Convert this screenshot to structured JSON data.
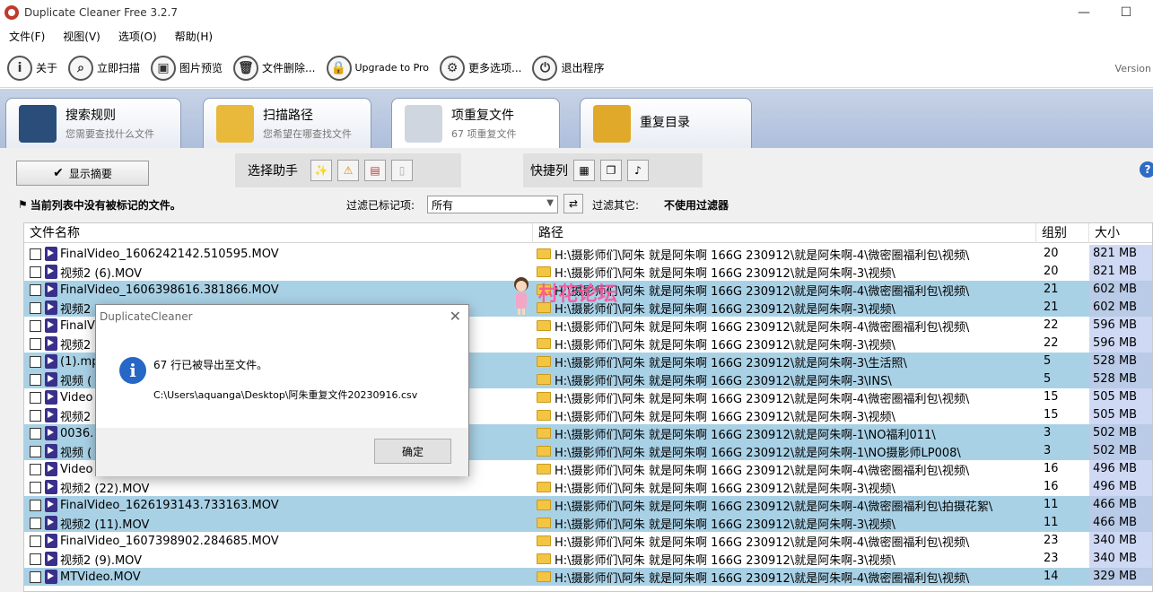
{
  "window": {
    "title": "Duplicate Cleaner Free 3.2.7",
    "minimize": "—",
    "maximize": "☐"
  },
  "menu": [
    "文件(F)",
    "视图(V)",
    "选项(O)",
    "帮助(H)"
  ],
  "toolbar": {
    "buttons": [
      {
        "label": "关于",
        "icon": "i"
      },
      {
        "label": "立即扫描",
        "icon": "⌕"
      },
      {
        "label": "图片预览",
        "icon": "▣"
      },
      {
        "label": "文件删除...",
        "icon": "🗑"
      },
      {
        "label": "Upgrade to Pro",
        "icon": "🔒"
      },
      {
        "label": "更多选项...",
        "icon": "⚙"
      },
      {
        "label": "退出程序",
        "icon": "⏻"
      }
    ],
    "version": "Version"
  },
  "tabs": [
    {
      "title": "搜索规则",
      "subtitle": "您需要查找什么文件",
      "icon_color": "#2b4d7a"
    },
    {
      "title": "扫描路径",
      "subtitle": "您希望在哪查找文件",
      "icon_color": "#e8b93a"
    },
    {
      "title": "项重复文件",
      "subtitle": "67 项重复文件",
      "icon_color": "#cfd6df"
    },
    {
      "title": "重复目录",
      "subtitle": "",
      "icon_color": "#e0a92a"
    }
  ],
  "panel": {
    "summary_button": "显示摘要",
    "helper_label": "选择助手",
    "quick_label": "快捷列",
    "status": "当前列表中没有被标记的文件。",
    "filter_marked_label": "过滤已标记项:",
    "filter_value": "所有",
    "filter_other_label": "过滤其它:",
    "filter_other_value": "不使用过滤器",
    "help": "?"
  },
  "table": {
    "headers": [
      "文件名称",
      "路径",
      "组别",
      "大小"
    ],
    "rows": [
      {
        "name": "FinalVideo_1606242142.510595.MOV",
        "path": "H:\\摄影师们\\阿朱 就是阿朱啊 166G 230912\\就是阿朱啊-4\\微密圈福利包\\视频\\",
        "group": "20",
        "size": "821 MB",
        "hl": false
      },
      {
        "name": "视频2 (6).MOV",
        "path": "H:\\摄影师们\\阿朱 就是阿朱啊 166G 230912\\就是阿朱啊-3\\视频\\",
        "group": "20",
        "size": "821 MB",
        "hl": false
      },
      {
        "name": "FinalVideo_1606398616.381866.MOV",
        "path": "H:\\摄影师们\\阿朱 就是阿朱啊 166G 230912\\就是阿朱啊-4\\微密圈福利包\\视频\\",
        "group": "21",
        "size": "602 MB",
        "hl": true
      },
      {
        "name": "视频2",
        "path": "H:\\摄影师们\\阿朱 就是阿朱啊 166G 230912\\就是阿朱啊-3\\视频\\",
        "group": "21",
        "size": "602 MB",
        "hl": true
      },
      {
        "name": "FinalV",
        "path": "H:\\摄影师们\\阿朱 就是阿朱啊 166G 230912\\就是阿朱啊-4\\微密圈福利包\\视频\\",
        "group": "22",
        "size": "596 MB",
        "hl": false
      },
      {
        "name": "视频2",
        "path": "H:\\摄影师们\\阿朱 就是阿朱啊 166G 230912\\就是阿朱啊-3\\视频\\",
        "group": "22",
        "size": "596 MB",
        "hl": false
      },
      {
        "name": "(1).mp",
        "path": "H:\\摄影师们\\阿朱 就是阿朱啊 166G 230912\\就是阿朱啊-3\\生活照\\",
        "group": "5",
        "size": "528 MB",
        "hl": true
      },
      {
        "name": "视频 (",
        "path": "H:\\摄影师们\\阿朱 就是阿朱啊 166G 230912\\就是阿朱啊-3\\INS\\",
        "group": "5",
        "size": "528 MB",
        "hl": true
      },
      {
        "name": "Video",
        "path": "H:\\摄影师们\\阿朱 就是阿朱啊 166G 230912\\就是阿朱啊-4\\微密圈福利包\\视频\\",
        "group": "15",
        "size": "505 MB",
        "hl": false
      },
      {
        "name": "视频2",
        "path": "H:\\摄影师们\\阿朱 就是阿朱啊 166G 230912\\就是阿朱啊-3\\视频\\",
        "group": "15",
        "size": "505 MB",
        "hl": false
      },
      {
        "name": "0036.",
        "path": "H:\\摄影师们\\阿朱 就是阿朱啊 166G 230912\\就是阿朱啊-1\\NO福利011\\",
        "group": "3",
        "size": "502 MB",
        "hl": true
      },
      {
        "name": "视频 (",
        "path": "H:\\摄影师们\\阿朱 就是阿朱啊 166G 230912\\就是阿朱啊-1\\NO摄影师LP008\\",
        "group": "3",
        "size": "502 MB",
        "hl": true
      },
      {
        "name": "Video",
        "path": "H:\\摄影师们\\阿朱 就是阿朱啊 166G 230912\\就是阿朱啊-4\\微密圈福利包\\视频\\",
        "group": "16",
        "size": "496 MB",
        "hl": false
      },
      {
        "name": "视频2 (22).MOV",
        "path": "H:\\摄影师们\\阿朱 就是阿朱啊 166G 230912\\就是阿朱啊-3\\视频\\",
        "group": "16",
        "size": "496 MB",
        "hl": false
      },
      {
        "name": "FinalVideo_1626193143.733163.MOV",
        "path": "H:\\摄影师们\\阿朱 就是阿朱啊 166G 230912\\就是阿朱啊-4\\微密圈福利包\\拍摄花絮\\",
        "group": "11",
        "size": "466 MB",
        "hl": true
      },
      {
        "name": "视频2 (11).MOV",
        "path": "H:\\摄影师们\\阿朱 就是阿朱啊 166G 230912\\就是阿朱啊-3\\视频\\",
        "group": "11",
        "size": "466 MB",
        "hl": true
      },
      {
        "name": "FinalVideo_1607398902.284685.MOV",
        "path": "H:\\摄影师们\\阿朱 就是阿朱啊 166G 230912\\就是阿朱啊-4\\微密圈福利包\\视频\\",
        "group": "23",
        "size": "340 MB",
        "hl": false
      },
      {
        "name": "视频2 (9).MOV",
        "path": "H:\\摄影师们\\阿朱 就是阿朱啊 166G 230912\\就是阿朱啊-3\\视频\\",
        "group": "23",
        "size": "340 MB",
        "hl": false
      },
      {
        "name": "MTVideo.MOV",
        "path": "H:\\摄影师们\\阿朱 就是阿朱啊 166G 230912\\就是阿朱啊-4\\微密圈福利包\\视频\\",
        "group": "14",
        "size": "329 MB",
        "hl": true
      }
    ]
  },
  "watermark": "村花论坛",
  "dialog": {
    "title": "DuplicateCleaner",
    "close": "✕",
    "icon": "i",
    "message": "67 行已被导出至文件。",
    "path": "C:\\Users\\aquanga\\Desktop\\阿朱重复文件20230916.csv",
    "ok": "确定"
  }
}
